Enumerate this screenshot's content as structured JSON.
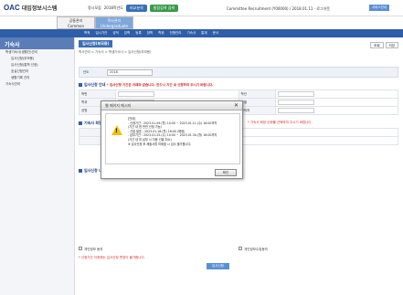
{
  "header": {
    "logo": "OAC",
    "logo_sub": "대입정보시스템",
    "menu": [
      "정시모집",
      "2018학년도",
      "비교분석",
      "통합검색 검색"
    ],
    "user": "Committee Recruitment (Y00000) / 2018.01.11 · 로그아웃",
    "top_button": "서비스안내"
  },
  "subtabs": [
    {
      "label": "공통관리",
      "sub": "Common"
    },
    {
      "label": "학사관리",
      "sub": "Undergraduate"
    }
  ],
  "nav": [
    "학적",
    "입시기관",
    "성적",
    "입학",
    "등록",
    "장학",
    "학위",
    "전형관리",
    "기숙사",
    "통계",
    "문서"
  ],
  "sidebar": {
    "title": "기숙사",
    "items": [
      {
        "label": "학생기숙사(생활관)관리",
        "level": 1
      },
      {
        "label": "입사신청(부모용)",
        "level": 2
      },
      {
        "label": "입사신청(통학 선정)",
        "level": 2
      },
      {
        "label": "호실신청관리",
        "level": 2
      },
      {
        "label": "생활기록 관리",
        "level": 2
      },
      {
        "label": "기숙사관리",
        "level": 1
      }
    ]
  },
  "main": {
    "title": "입사신청(부모용)",
    "breadcrumb": "학사관리 > 기숙사 > 학생기숙사 > 입사신청(부모용)",
    "buttons": [
      "조회",
      "저장"
    ],
    "search_label": "년도",
    "search_value": "2018",
    "section1": "입사신청 안내",
    "notice1": "* 입사신청 기간은 아래와 같습니다. 반드시 기간 내 신청하여 주시기 바랍니다.",
    "fields": [
      "학번",
      "학과",
      "성명",
      "학년",
      "성별",
      "연락처"
    ],
    "section2": "기숙사 희망",
    "notice2": "* 기숙사 희망 순위를 선택하여 주시기 바랍니다.",
    "section3": "입사신청 내역",
    "check1": "개인정보 동의",
    "check2": "개인정보수집동의",
    "footnote": "* 신청기간 이후에는 입사신청 변경이 불가합니다.",
    "submit": "입사신청"
  },
  "modal": {
    "title": "웹 페이지 메시지",
    "message_lines": [
      "[안내]",
      "- 신청기간 : 2023.01.09.(월) 10:00 ~ 2023.01.11.(수) 16:00까지",
      "  (기간 내 한 번만 신청 가능)",
      "- 선발 발표 : 2023.01.16.(월) 16:00 (예정)",
      "- 납부기간 : 2023.01.25.(수) 10:00 ~ 2023.01.30.(월) 16:00까지",
      "  (기간 내 미 납부 시 자동 선발 취소)",
      "※ 입사신청 후 제출서류 미제출 시 입사 불가합니다."
    ],
    "ok_label": "확인"
  }
}
